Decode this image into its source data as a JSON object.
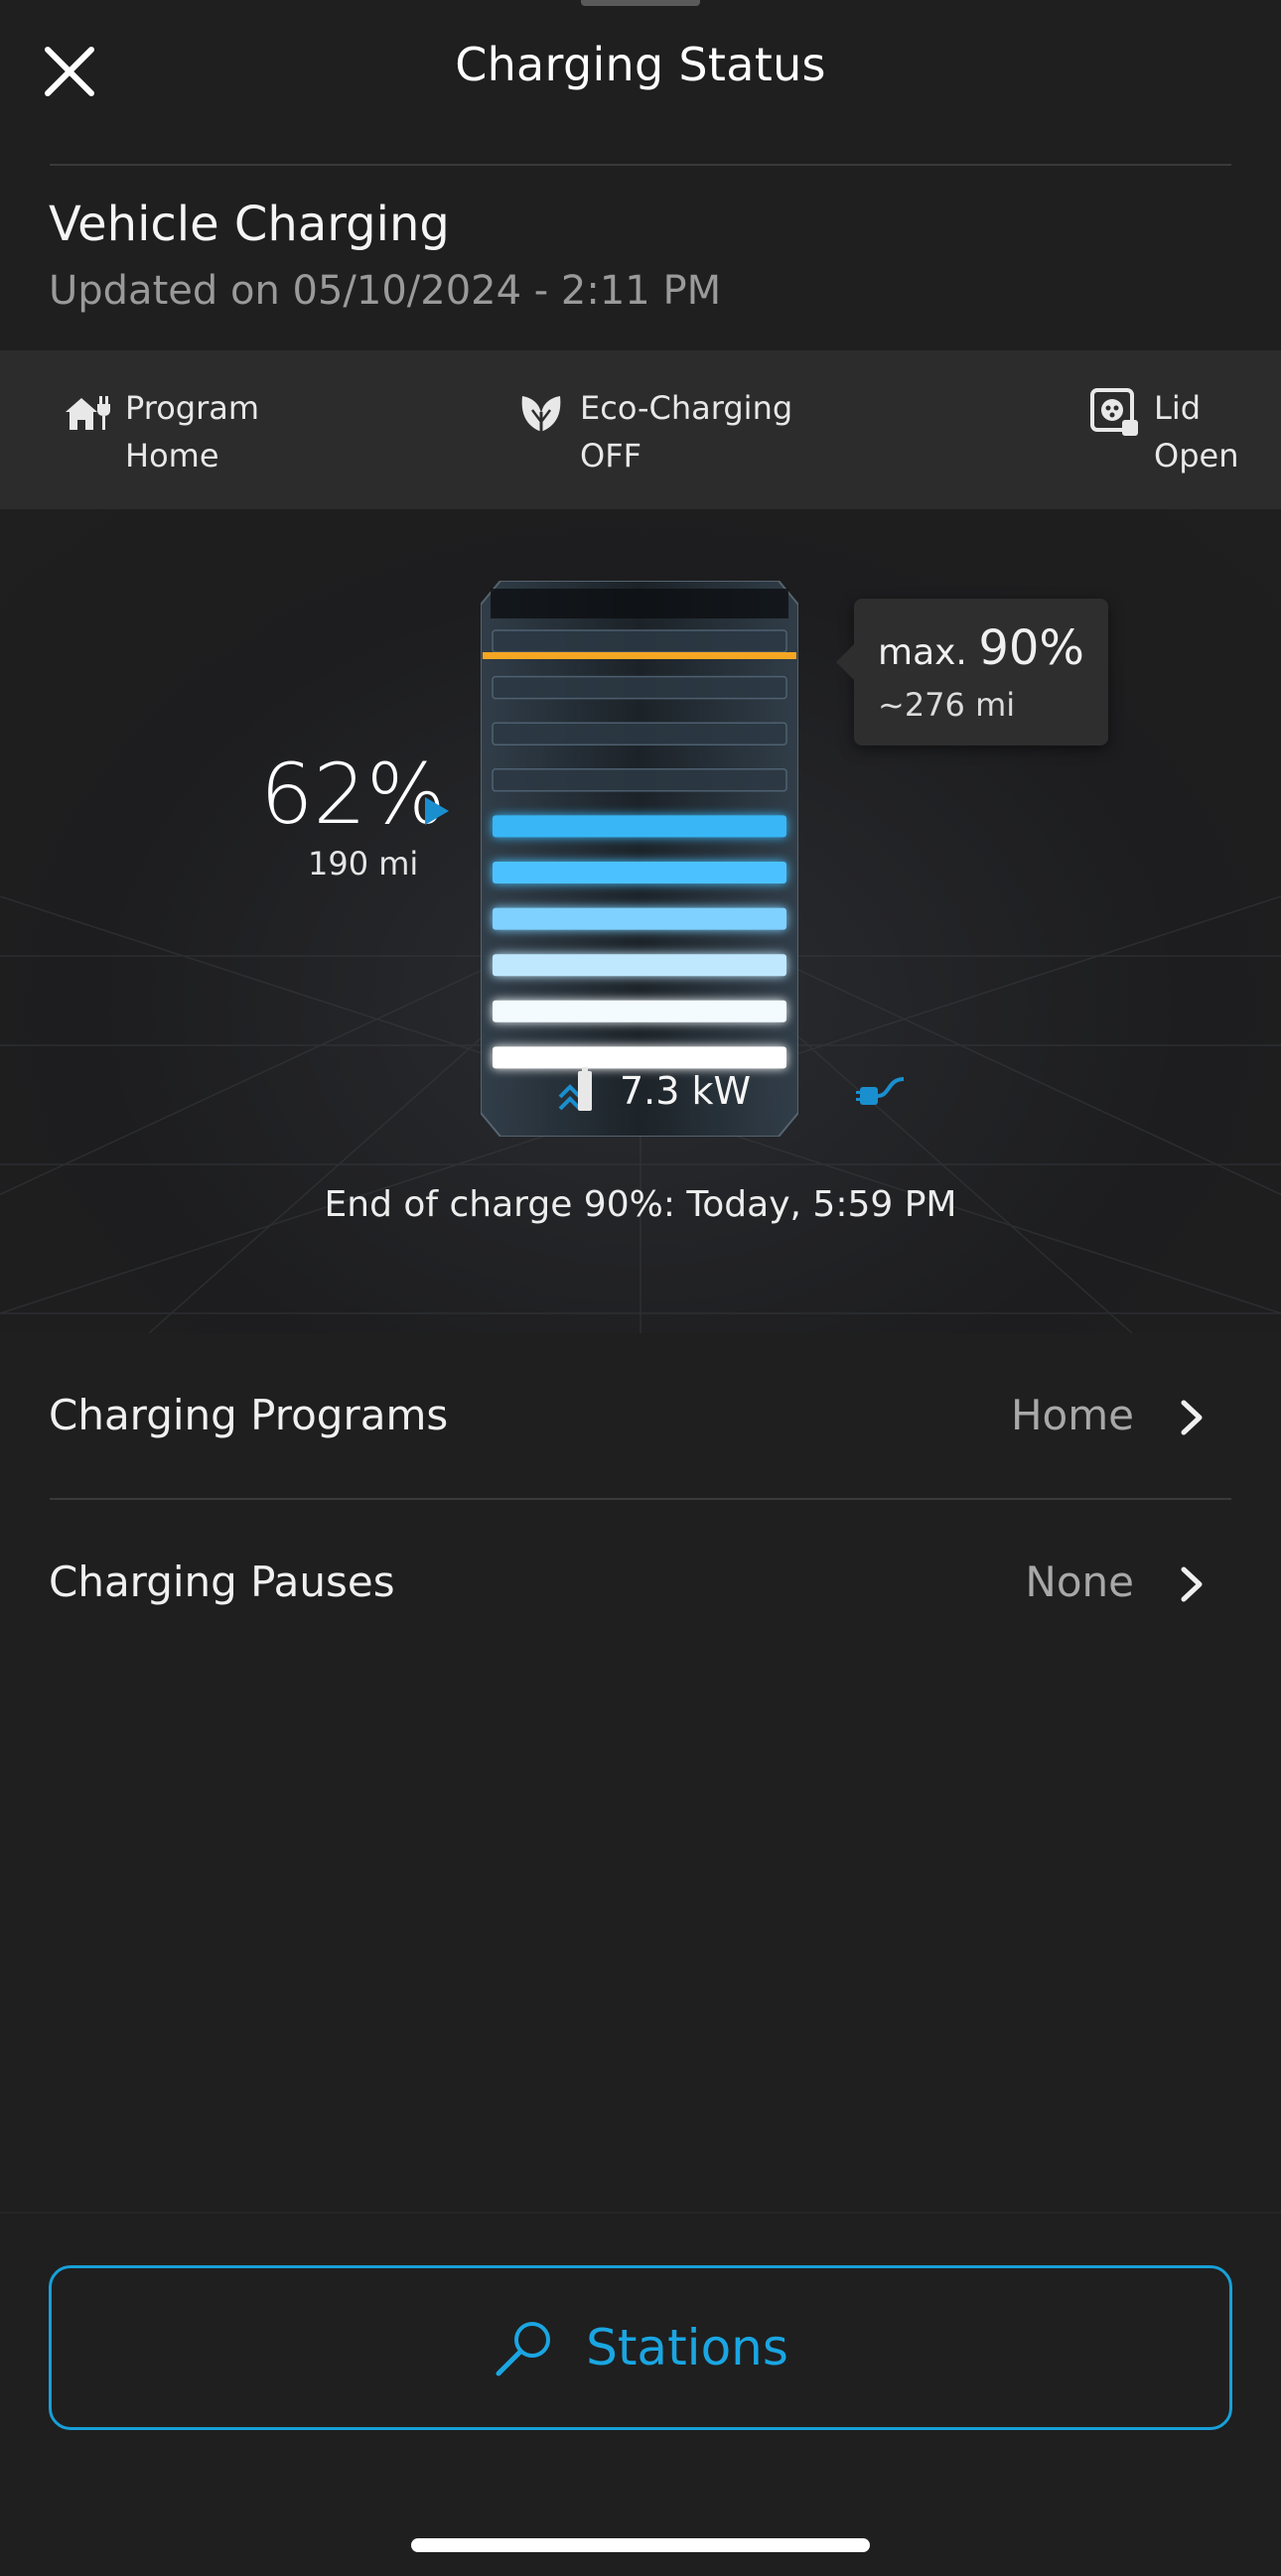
{
  "header": {
    "title": "Charging Status",
    "close_icon": "close-icon"
  },
  "vehicle": {
    "title": "Vehicle Charging",
    "updated": "Updated on 05/10/2024 - 2:11 PM"
  },
  "info_strip": {
    "program": {
      "icon": "home-plug-icon",
      "label": "Program",
      "value": "Home"
    },
    "eco": {
      "icon": "leaf-icon",
      "label": "Eco-Charging",
      "value": "OFF"
    },
    "lid": {
      "icon": "charge-lid-icon",
      "label": "Lid",
      "value": "Open"
    }
  },
  "battery": {
    "current_percent": "62%",
    "current_range": "190 mi",
    "level_fraction": 0.62,
    "max_label": "max.",
    "max_percent": "90%",
    "max_range": "~276 mi",
    "power": "7.3 kW",
    "end_of_charge_label": "End of charge 90%:",
    "end_of_charge_time": "Today, 5:59 PM",
    "colors": {
      "limit": "#f5a623",
      "accent": "#1aa6e2"
    }
  },
  "list": {
    "programs": {
      "label": "Charging Programs",
      "value": "Home"
    },
    "pauses": {
      "label": "Charging Pauses",
      "value": "None"
    }
  },
  "footer": {
    "stations_label": "Stations",
    "stations_icon": "search-icon"
  }
}
